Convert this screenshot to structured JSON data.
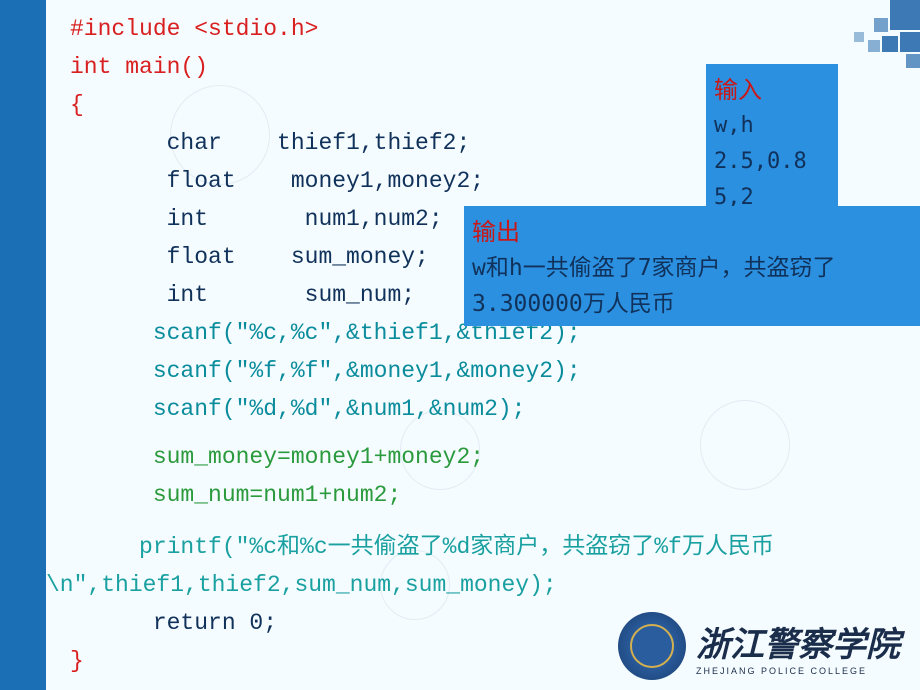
{
  "code": {
    "line1": "#include <stdio.h>",
    "line2": "int main()",
    "line3": "{",
    "line4": "       char    thief1,thief2;",
    "line5": "       float    money1,money2;",
    "line6": "       int       num1,num2;",
    "line7": "       float    sum_money;",
    "line8": "       int       sum_num;",
    "line9": "      scanf(\"%c,%c\",&thief1,&thief2);",
    "line10": "      scanf(\"%f,%f\",&money1,&money2);",
    "line11": "      scanf(\"%d,%d\",&num1,&num2);",
    "line12": "      sum_money=money1+money2;",
    "line13": "      sum_num=num1+num2;",
    "line14a": "     printf(\"%c和%c一共偷盗了%d家商户，共盗窃了%f万人民币",
    "line14b": "\\n\",thief1,thief2,sum_num,sum_money);",
    "line15": "      return 0;",
    "line16": "}"
  },
  "input": {
    "title": "输入",
    "line1": "w,h",
    "line2": "2.5,0.8",
    "line3": "5,2"
  },
  "output": {
    "title": "输出",
    "line1": "w和h一共偷盗了7家商户，共盗窃了",
    "line2": "3.300000万人民币"
  },
  "logo": {
    "text": "浙江警察学院",
    "sub": "ZHEJIANG POLICE COLLEGE"
  }
}
